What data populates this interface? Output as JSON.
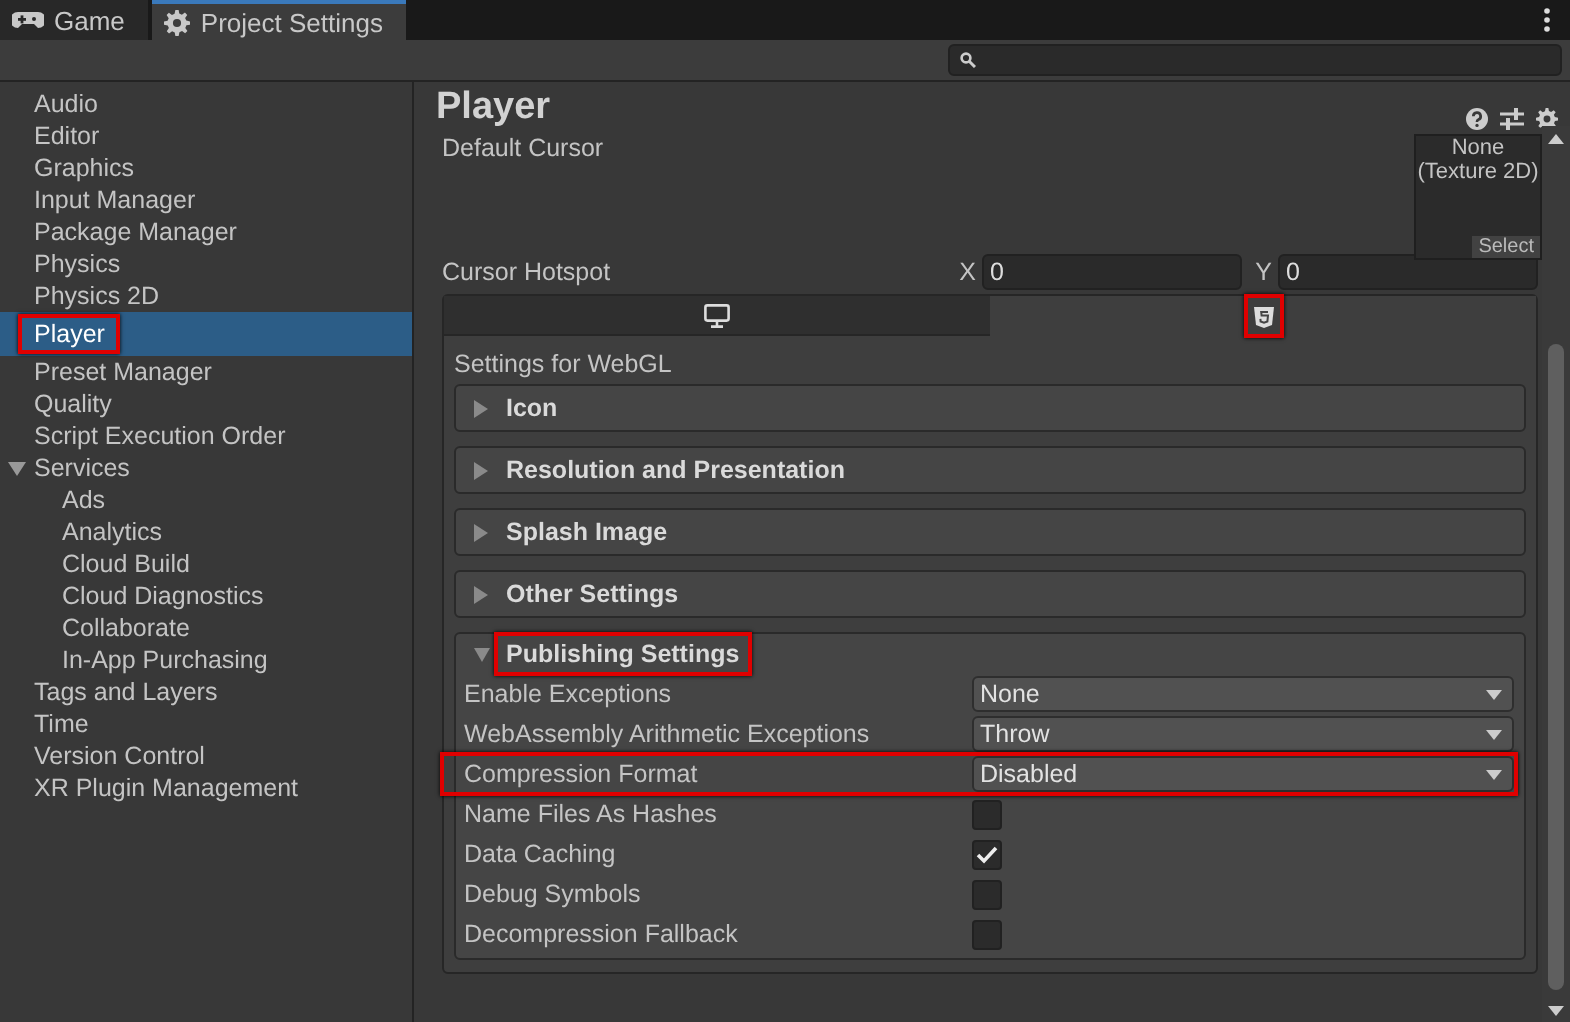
{
  "tabs": [
    {
      "label": "Game",
      "selected": false
    },
    {
      "label": "Project Settings",
      "selected": true
    }
  ],
  "sidebar": {
    "items": [
      {
        "label": "Audio",
        "selected": false,
        "highlighted": false
      },
      {
        "label": "Editor",
        "selected": false,
        "highlighted": false
      },
      {
        "label": "Graphics",
        "selected": false,
        "highlighted": false
      },
      {
        "label": "Input Manager",
        "selected": false,
        "highlighted": false
      },
      {
        "label": "Package Manager",
        "selected": false,
        "highlighted": false
      },
      {
        "label": "Physics",
        "selected": false,
        "highlighted": false
      },
      {
        "label": "Physics 2D",
        "selected": false,
        "highlighted": false
      },
      {
        "label": "Player",
        "selected": true,
        "highlighted": true
      },
      {
        "label": "Preset Manager",
        "selected": false,
        "highlighted": false
      },
      {
        "label": "Quality",
        "selected": false,
        "highlighted": false
      },
      {
        "label": "Script Execution Order",
        "selected": false,
        "highlighted": false
      },
      {
        "label": "Services",
        "selected": false,
        "highlighted": false,
        "expanded": true,
        "children": [
          {
            "label": "Ads",
            "selected": false,
            "highlighted": false
          },
          {
            "label": "Analytics",
            "selected": false,
            "highlighted": false
          },
          {
            "label": "Cloud Build",
            "selected": false,
            "highlighted": false
          },
          {
            "label": "Cloud Diagnostics",
            "selected": false,
            "highlighted": false
          },
          {
            "label": "Collaborate",
            "selected": false,
            "highlighted": false
          },
          {
            "label": "In-App Purchasing",
            "selected": false,
            "highlighted": false
          }
        ]
      },
      {
        "label": "Tags and Layers",
        "selected": false,
        "highlighted": false
      },
      {
        "label": "Time",
        "selected": false,
        "highlighted": false
      },
      {
        "label": "Version Control",
        "selected": false,
        "highlighted": false
      },
      {
        "label": "XR Plugin Management",
        "selected": false,
        "highlighted": false
      }
    ]
  },
  "panel": {
    "title": "Player",
    "default_cursor": {
      "label": "Default Cursor",
      "texture_value": "None",
      "texture_type": "(Texture 2D)",
      "select_button": "Select"
    },
    "cursor_hotspot": {
      "label": "Cursor Hotspot",
      "x_label": "X",
      "x_value": "0",
      "y_label": "Y",
      "y_value": "0"
    },
    "platform_tabs": [
      {
        "selected": false,
        "highlighted": false
      },
      {
        "selected": true,
        "highlighted": true
      }
    ],
    "settings_heading": "Settings for WebGL",
    "sections": [
      {
        "label": "Icon",
        "expanded": false,
        "highlighted": false
      },
      {
        "label": "Resolution and Presentation",
        "expanded": false,
        "highlighted": false
      },
      {
        "label": "Splash Image",
        "expanded": false,
        "highlighted": false
      },
      {
        "label": "Other Settings",
        "expanded": false,
        "highlighted": false
      },
      {
        "label": "Publishing Settings",
        "expanded": true,
        "highlighted": true
      }
    ],
    "publishing_rows": [
      {
        "kind": "dropdown",
        "label": "Enable Exceptions",
        "value": "None",
        "highlighted": false
      },
      {
        "kind": "dropdown",
        "label": "WebAssembly Arithmetic Exceptions",
        "value": "Throw",
        "highlighted": false
      },
      {
        "kind": "dropdown",
        "label": "Compression Format",
        "value": "Disabled",
        "highlighted": true
      },
      {
        "kind": "checkbox",
        "label": "Name Files As Hashes",
        "checked": false,
        "highlighted": false
      },
      {
        "kind": "checkbox",
        "label": "Data Caching",
        "checked": true,
        "highlighted": false
      },
      {
        "kind": "checkbox",
        "label": "Debug Symbols",
        "checked": false,
        "highlighted": false
      },
      {
        "kind": "checkbox",
        "label": "Decompression Fallback",
        "checked": false,
        "highlighted": false
      }
    ]
  }
}
